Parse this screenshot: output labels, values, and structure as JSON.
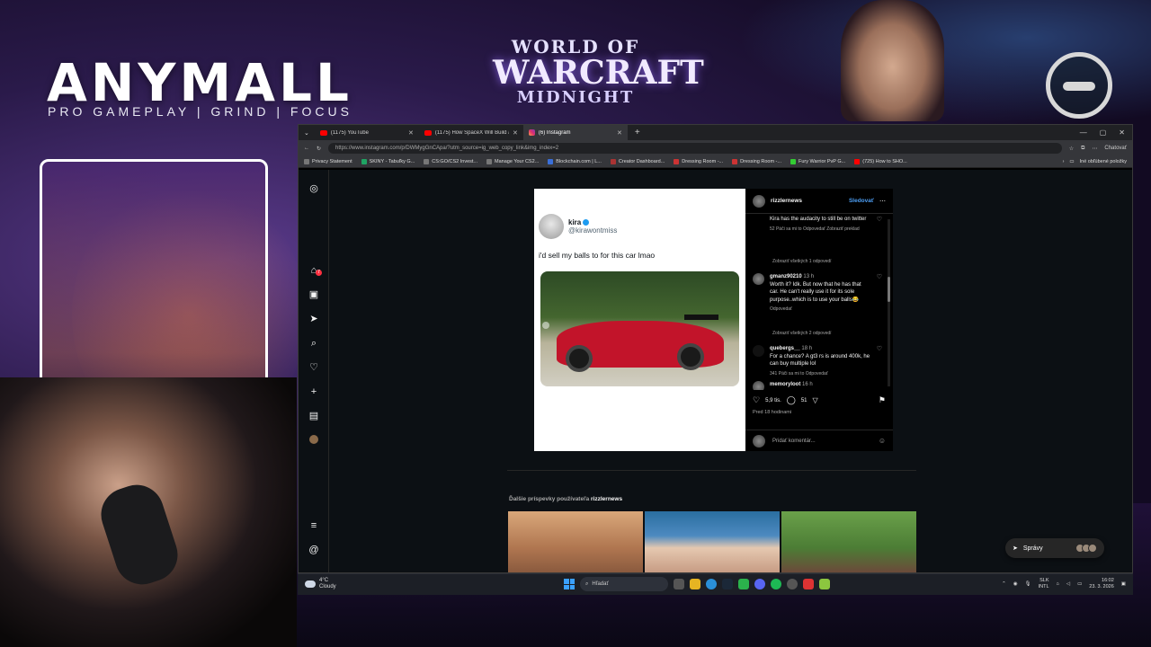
{
  "overlay": {
    "brand_title": "ANYMALL",
    "brand_subtitle": "PRO GAMEPLAY | GRIND | FOCUS",
    "game_logo": {
      "line1": "WORLD OF",
      "line2": "WARCRAFT",
      "line3": "MIDNIGHT"
    }
  },
  "browser": {
    "tabs": [
      {
        "label": "(1175) YouTube",
        "icon": "youtube-icon",
        "active": false
      },
      {
        "label": "(1175) How SpaceX Will Build a C...",
        "icon": "youtube-icon",
        "active": false
      },
      {
        "label": "(6) Instagram",
        "icon": "instagram-icon",
        "active": true
      }
    ],
    "url": "https://www.instagram.com/p/DWMygGnCApa/?utm_source=ig_web_copy_link&img_index=2",
    "copilot_label": "Chatovať",
    "bookmarks": [
      "Privacy Statement",
      "SKINY - Tabuľky G...",
      "CS:GO/CS2 Invest...",
      "Manage Your CS2...",
      "Blockchain.com | L...",
      "Creator Dashboard...",
      "Dressing Room -...",
      "Dressing Room -...",
      "Fury Warrior PvP G...",
      "(725) How to SHO..."
    ],
    "other_bookmarks": "Iné obľúbené položky"
  },
  "instagram": {
    "sidebar": {
      "icons": [
        "instagram-icon",
        "home-icon",
        "reels-icon",
        "messenger-icon",
        "search-icon",
        "heart-icon",
        "create-icon",
        "dashboard-icon",
        "profile-avatar",
        "menu-icon",
        "threads-icon"
      ],
      "message_badge": "7"
    },
    "post": {
      "tweet": {
        "name": "kira",
        "handle": "@kirawontmiss",
        "text": "i'd sell my balls to for this car lmao"
      },
      "author": "rizzlernews",
      "follow_label": "Sledovať",
      "comments": [
        {
          "user": "",
          "text": "Kira has the audacity to still be on twitter",
          "meta": "52 Páči sa mi to   Odpovedať   Zobraziť preklad"
        },
        {
          "user": "gmanz90210",
          "time": "13 h",
          "text": "Worth it? Idk. But now that he has that car. He can't really use it for its sole purpose..which is to use your balls😂",
          "meta": "Odpovedať"
        },
        {
          "user": "quebergs__",
          "time": "18 h",
          "text": "For a chance? A gt3 rs is around 400k, he can buy multiple lol",
          "meta": "341 Páči sa mi to   Odpovedať"
        },
        {
          "user": "memoryloot",
          "time": "16 h",
          "text": "",
          "meta": ""
        }
      ],
      "view_replies": [
        "Zobraziť všetkých 1 odpovedí",
        "Zobraziť všetkých 2 odpovedí"
      ],
      "likes": "5,9 tis.",
      "comment_count": "51",
      "posted_ago": "Pred 18 hodinami",
      "add_comment_placeholder": "Pridať komentár..."
    },
    "more_posts_prefix": "Ďalšie príspevky používateľa",
    "more_posts_user": "rizzlernews",
    "messages_label": "Správy"
  },
  "taskbar": {
    "weather_temp": "4°C",
    "weather_desc": "Cloudy",
    "search_label": "Hľadať",
    "language": "SLK",
    "layout": "INTL",
    "time": "16:02",
    "date": "23. 3. 2026"
  },
  "colors": {
    "accent_blue": "#4d9ff5",
    "ig_bg": "#0c1014",
    "badge_red": "#ff3040"
  }
}
